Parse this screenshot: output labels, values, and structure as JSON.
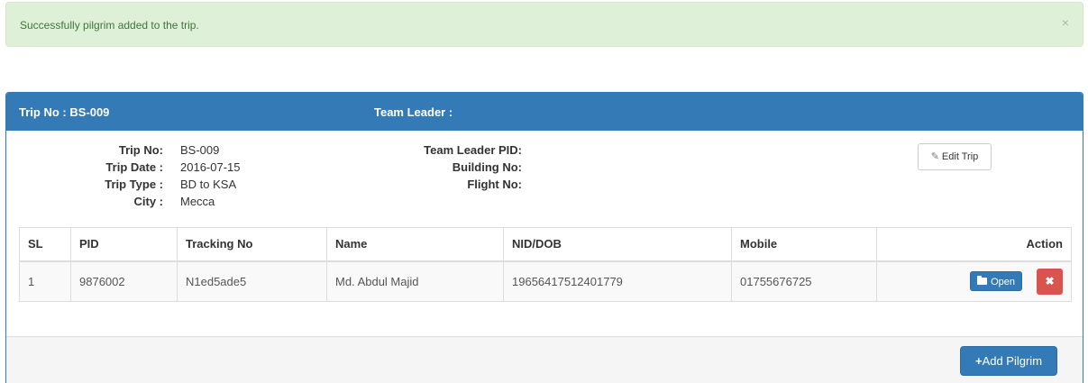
{
  "alert": {
    "message": "Successfully pilgrim added to the trip.",
    "close": "×"
  },
  "header": {
    "trip_label": "Trip No : BS-009",
    "leader_label": "Team Leader :"
  },
  "trip_info": {
    "labels": [
      "Trip No:",
      "Trip Date :",
      "Trip Type :",
      "City :"
    ],
    "values": [
      "BS-009",
      "2016-07-15",
      "BD to KSA",
      "Mecca"
    ],
    "leader_labels": [
      "Team Leader PID:",
      "Building No:",
      "Flight No:"
    ]
  },
  "edit_button": {
    "icon": "✎",
    "label": "Edit Trip"
  },
  "table": {
    "headers": [
      "SL",
      "PID",
      "Tracking No",
      "Name",
      "NID/DOB",
      "Mobile",
      "Action"
    ],
    "rows": [
      [
        "1",
        "9876002",
        "N1ed5ade5",
        "Md. Abdul Majid",
        "19656417512401779",
        "01755676725"
      ]
    ],
    "open_label": "Open",
    "delete_label": "✖"
  },
  "footer": {
    "add_label": "Add Pilgrim",
    "add_icon": "+"
  }
}
